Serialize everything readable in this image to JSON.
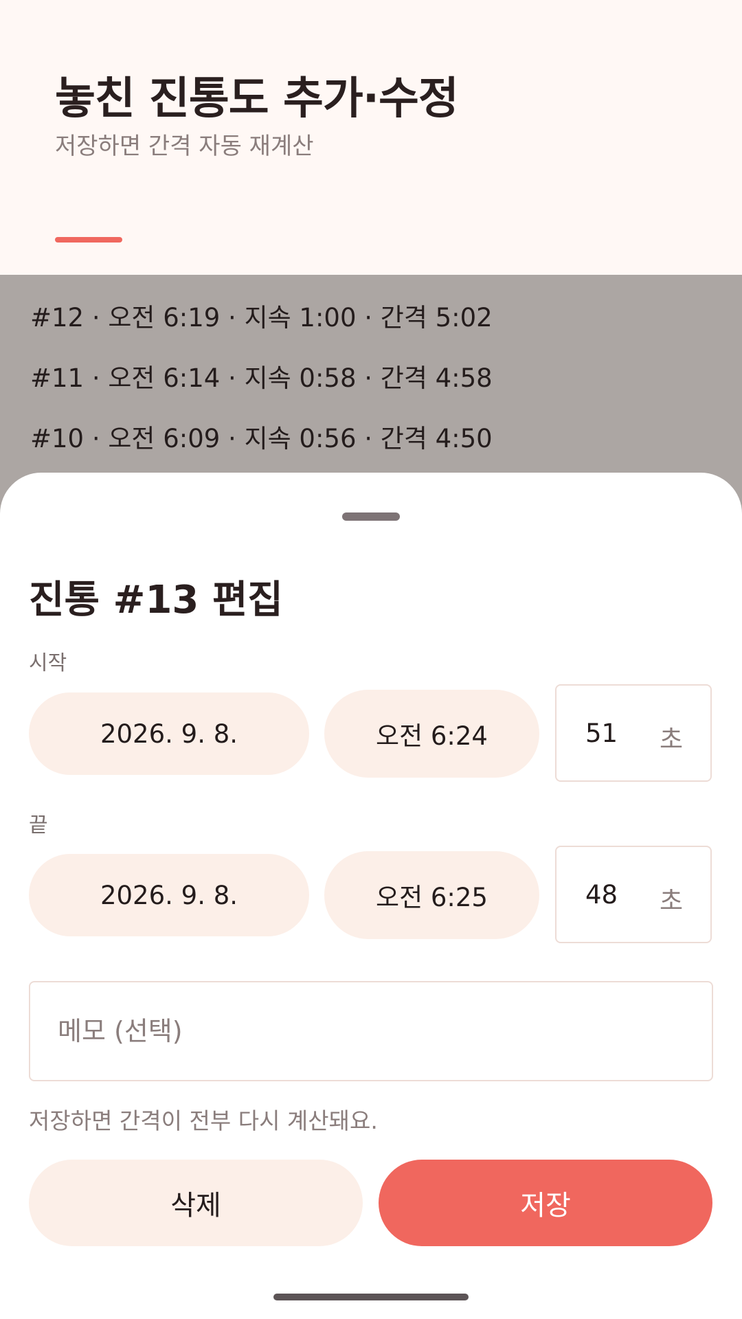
{
  "header": {
    "title": "놓친 진통도 추가·수정",
    "subtitle": "저장하면 간격 자동 재계산"
  },
  "list": {
    "items": [
      "#12 · 오전 6:19 · 지속 1:00 · 간격 5:02",
      "#11 · 오전 6:14 · 지속 0:58 · 간격 4:58",
      "#10 · 오전 6:09 · 지속 0:56 · 간격 4:50"
    ]
  },
  "sheet": {
    "title": "진통 #13 편집",
    "start": {
      "label": "시작",
      "date": "2026. 9. 8.",
      "time": "오전 6:24",
      "seconds": "51",
      "seconds_unit": "초"
    },
    "end": {
      "label": "끝",
      "date": "2026. 9. 8.",
      "time": "오전 6:25",
      "seconds": "48",
      "seconds_unit": "초"
    },
    "memo": {
      "value": "",
      "placeholder": "메모 (선택)"
    },
    "helper": "저장하면 간격이 전부 다시 계산돼요.",
    "delete_label": "삭제",
    "save_label": "저장"
  },
  "colors": {
    "accent": "#f0675e",
    "pill_bg": "#fcefe8",
    "header_bg": "#fff8f5",
    "scrim": "#aca6a3"
  }
}
